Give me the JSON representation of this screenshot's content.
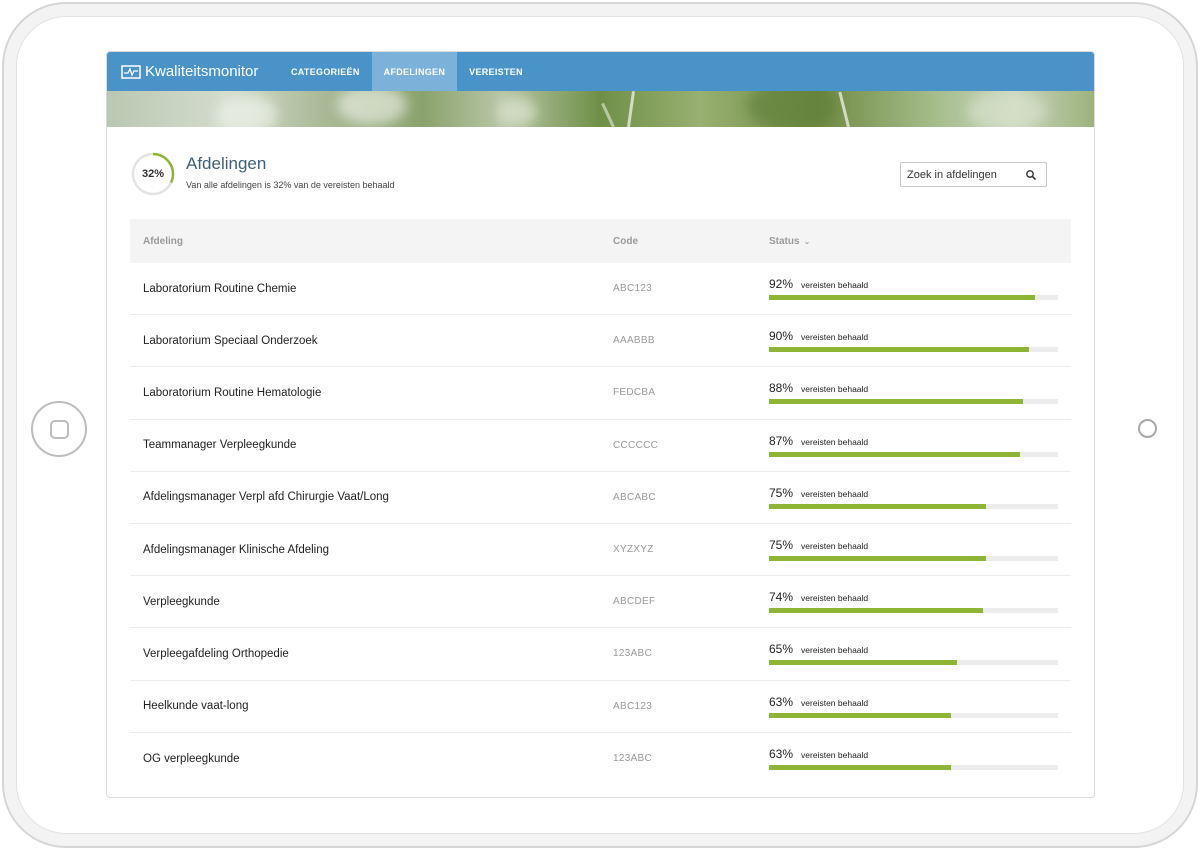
{
  "app": {
    "brand": "Kwaliteitsmonitor",
    "nav": [
      {
        "label": "CATEGORIEËN",
        "active": false
      },
      {
        "label": "AFDELINGEN",
        "active": true
      },
      {
        "label": "VEREISTEN",
        "active": false
      }
    ],
    "accent_color": "#4a93c9",
    "progress_color": "#8fb536"
  },
  "header": {
    "overall_percent_label": "32%",
    "overall_fraction": 0.32,
    "title": "Afdelingen",
    "subtitle": "Van alle afdelingen is 32% van de vereisten behaald"
  },
  "search": {
    "placeholder": "Zoek in afdelingen",
    "icon": "search-icon"
  },
  "table": {
    "columns": {
      "name": "Afdeling",
      "code": "Code",
      "status": "Status"
    },
    "status_suffix": "vereisten behaald",
    "rows": [
      {
        "name": "Laboratorium Routine Chemie",
        "code": "ABC123",
        "percent": "92%",
        "fraction": 0.92
      },
      {
        "name": "Laboratorium Speciaal Onderzoek",
        "code": "AAABBB",
        "percent": "90%",
        "fraction": 0.9
      },
      {
        "name": "Laboratorium Routine Hematologie",
        "code": "FEDCBA",
        "percent": "88%",
        "fraction": 0.88
      },
      {
        "name": "Teammanager Verpleegkunde",
        "code": "CCCCCC",
        "percent": "87%",
        "fraction": 0.87
      },
      {
        "name": "Afdelingsmanager Verpl afd Chirurgie Vaat/Long",
        "code": "ABCABC",
        "percent": "75%",
        "fraction": 0.75
      },
      {
        "name": "Afdelingsmanager Klinische Afdeling",
        "code": "XYZXYZ",
        "percent": "75%",
        "fraction": 0.75
      },
      {
        "name": "Verpleegkunde",
        "code": "ABCDEF",
        "percent": "74%",
        "fraction": 0.74
      },
      {
        "name": "Verpleegafdeling Orthopedie",
        "code": "123ABC",
        "percent": "65%",
        "fraction": 0.65
      },
      {
        "name": "Heelkunde vaat-long",
        "code": "ABC123",
        "percent": "63%",
        "fraction": 0.63
      },
      {
        "name": "OG verpleegkunde",
        "code": "123ABC",
        "percent": "63%",
        "fraction": 0.63
      }
    ]
  }
}
